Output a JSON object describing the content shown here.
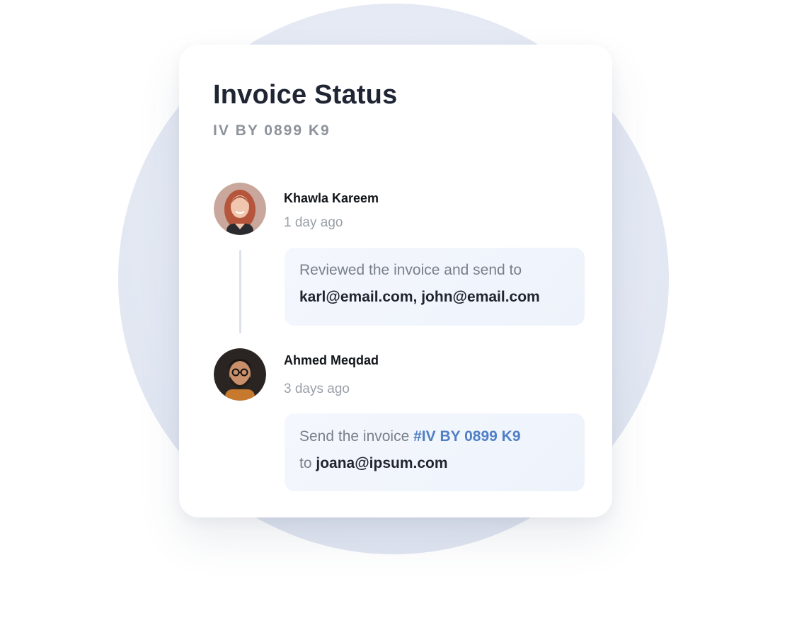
{
  "card": {
    "title": "Invoice Status",
    "invoice_id": "IV BY 0899 K9"
  },
  "activity": [
    {
      "name": "Khawla Kareem",
      "time": "1 day ago",
      "message_text": "Reviewed the invoice and send to",
      "recipients": "karl@email.com,  john@email.com"
    },
    {
      "name": "Ahmed Meqdad",
      "time": "3 days ago",
      "message_prefix": "Send the invoice",
      "invoice_link": "#IV BY 0899 K9",
      "message_to": "to",
      "recipient": "joana@ipsum.com"
    }
  ],
  "colors": {
    "background_circle": "#e3e8f3",
    "card": "#ffffff",
    "title": "#1f2533",
    "muted": "#8d929b",
    "bubble": "#f1f5fc",
    "link": "#4f7fc6"
  }
}
